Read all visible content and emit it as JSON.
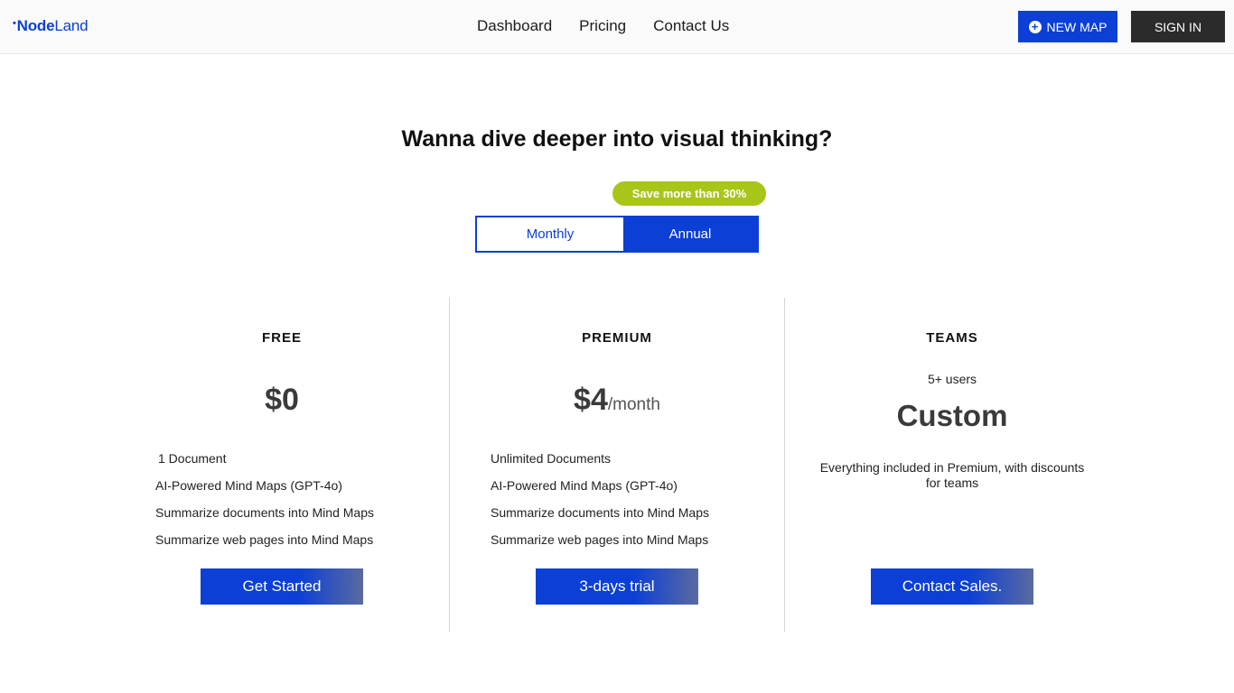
{
  "header": {
    "logo": {
      "dot": "•",
      "node": "Node",
      "land": "Land"
    },
    "nav": [
      "Dashboard",
      "Pricing",
      "Contact Us"
    ],
    "new_map_label": "NEW MAP",
    "sign_in_label": "SIGN IN"
  },
  "main": {
    "headline": "Wanna dive deeper into visual thinking?",
    "save_badge": "Save more than 30%",
    "billing_toggle": {
      "monthly": "Monthly",
      "annual": "Annual",
      "selected": "Annual"
    }
  },
  "plans": [
    {
      "title": "FREE",
      "price": "$0",
      "features": [
        "1 Document",
        "AI-Powered Mind Maps (GPT-4o)",
        "Summarize documents into Mind Maps",
        "Summarize web pages into Mind Maps"
      ],
      "cta": "Get Started"
    },
    {
      "title": "PREMIUM",
      "price": "$4",
      "price_suffix": "/month",
      "features": [
        "Unlimited Documents",
        "AI-Powered Mind Maps (GPT-4o)",
        "Summarize documents into Mind Maps",
        "Summarize web pages into Mind Maps"
      ],
      "cta": "3-days trial"
    },
    {
      "title": "TEAMS",
      "users": "5+ users",
      "price": "Custom",
      "description": "Everything included in Premium, with discounts for teams",
      "cta": "Contact Sales."
    }
  ],
  "colors": {
    "brand": "#0b3fd6",
    "badge": "#a8c51a",
    "dark": "#2b2b2b"
  },
  "icons": {
    "new_map": "plus-circle-icon"
  }
}
